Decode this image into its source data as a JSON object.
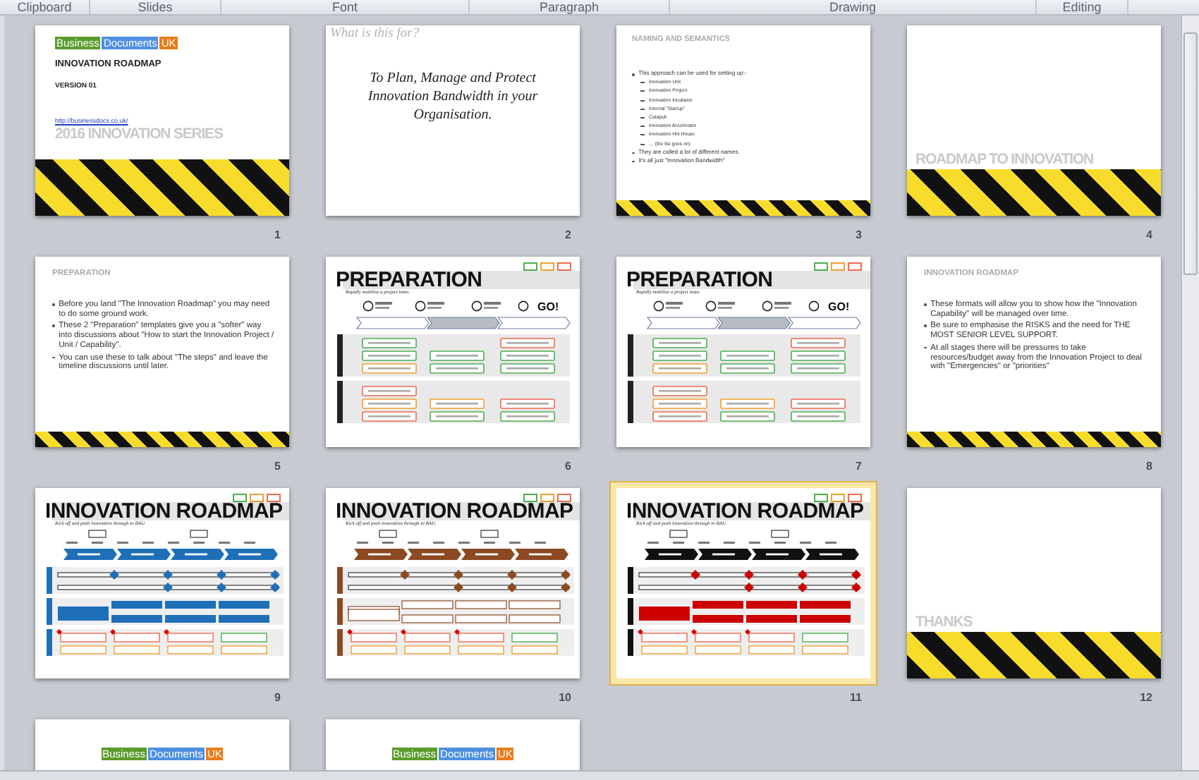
{
  "ribbon_groups": [
    "Clipboard",
    "Slides",
    "Font",
    "Paragraph",
    "Drawing",
    "Editing"
  ],
  "slides": [
    {
      "number": "1",
      "selected": false,
      "kind": "title",
      "logo": [
        "Business",
        "Documents",
        "UK"
      ],
      "title": "INNOVATION ROADMAP",
      "subtitle": "VERSION 01",
      "link": "http://businessdocs.co.uk/",
      "series": "2016 INNOVATION  SERIES"
    },
    {
      "number": "2",
      "selected": false,
      "kind": "statement",
      "heading": "What is this for?",
      "statement": "To Plan, Manage and Protect Innovation Bandwidth in your Organisation."
    },
    {
      "number": "3",
      "selected": false,
      "kind": "bullets",
      "title": "NAMING AND SEMANTICS",
      "bullets": [
        {
          "text": "This approach  can be used  for setting up:-",
          "children": [
            {
              "text": "Innovation Unit"
            },
            {
              "text": "Innovation Project"
            },
            {
              "text": "Innovation Incubator"
            },
            {
              "text": "Internal \"Startup\""
            },
            {
              "text": "Catapult"
            },
            {
              "text": "Innovation Accelerator"
            },
            {
              "text": "Innovation Hot House"
            },
            {
              "text": "… (the list goes on)"
            }
          ]
        },
        {
          "text": "They  are called a lot of different  names."
        },
        {
          "text": "It's all just \"Innovation  Bandwidth\""
        }
      ]
    },
    {
      "number": "4",
      "selected": false,
      "kind": "divider",
      "title": "ROADMAP  TO INNOVATION"
    },
    {
      "number": "5",
      "selected": false,
      "kind": "bullets",
      "title": "PREPARATION",
      "bullets": [
        {
          "text": "Before you land \"The  Innovation Roadmap\" you may need to do some ground work."
        },
        {
          "text": "These 2 \"Preparation\"  templates give you a \"softer\" way into discussions about \"How to start the Innovation Project / Unit / Capability\"."
        },
        {
          "text": "You can use these to talk about \"The steps\" and leave the timeline discussions until later."
        }
      ]
    },
    {
      "number": "6",
      "selected": false,
      "kind": "preparation",
      "title": "PREPARATION",
      "subtitle": "Rapidly mobilise a project team.",
      "go_label": "GO!"
    },
    {
      "number": "7",
      "selected": false,
      "kind": "preparation",
      "title": "PREPARATION",
      "subtitle": "Rapidly mobilise a project team.",
      "go_label": "GO!"
    },
    {
      "number": "8",
      "selected": false,
      "kind": "bullets",
      "title": "INNOVATION ROADMAP",
      "bullets": [
        {
          "text": "These  formats will allow you to show how  the \"Innovation Capability\" will be managed  over time."
        },
        {
          "text": "Be sure to emphasise the RISKS and the need for THE MOST  SENIOR LEVEL  SUPPORT."
        },
        {
          "text": "At all stages there will be pressures to take resources/budget away from the Innovation Project to deal with  \"Emergencies\" or \"priorities\""
        }
      ]
    },
    {
      "number": "9",
      "selected": false,
      "kind": "roadmap",
      "title": "INNOVATION ROADMAP",
      "subtitle": "Kick off and push innovation through to BAU.",
      "color": "#1f6fb8"
    },
    {
      "number": "10",
      "selected": false,
      "kind": "roadmap",
      "title": "INNOVATION ROADMAP",
      "subtitle": "Kick off and push innovation through to BAU.",
      "color": "#8b4a22"
    },
    {
      "number": "11",
      "selected": true,
      "kind": "roadmap",
      "title": "INNOVATION ROADMAP",
      "subtitle": "Kick off and push innovation through to BAU.",
      "color": "#111111"
    },
    {
      "number": "12",
      "selected": false,
      "kind": "divider",
      "title": "THANKS"
    },
    {
      "kind": "logo",
      "selected": false,
      "logo": [
        "Business",
        "Documents",
        "UK"
      ]
    },
    {
      "kind": "logo",
      "selected": false,
      "logo": [
        "Business",
        "Documents",
        "UK"
      ]
    }
  ]
}
